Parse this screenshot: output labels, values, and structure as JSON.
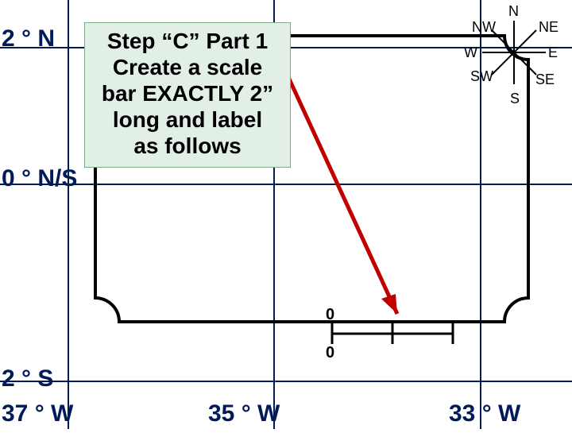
{
  "lat": {
    "n2": "2 ° N",
    "ns0": "0 ° N/S",
    "s2": "2 ° S"
  },
  "lon": {
    "w37": "37 ° W",
    "w35": "35 ° W",
    "w33": "33 ° W"
  },
  "callout": {
    "l1": "Step “C” Part 1",
    "l2": "Create a scale",
    "l3": "bar EXACTLY 2”",
    "l4": "long and label",
    "l5": "as follows"
  },
  "compass": {
    "n": "N",
    "ne": "NE",
    "e": "E",
    "se": "SE",
    "s": "S",
    "sw": "SW",
    "w": "W",
    "nw": "NW"
  },
  "scale": {
    "top": "0",
    "bottom": "0"
  },
  "colors": {
    "ink": "#001b58",
    "arrow": "#c00000",
    "calloutBg": "#e2efe6"
  }
}
